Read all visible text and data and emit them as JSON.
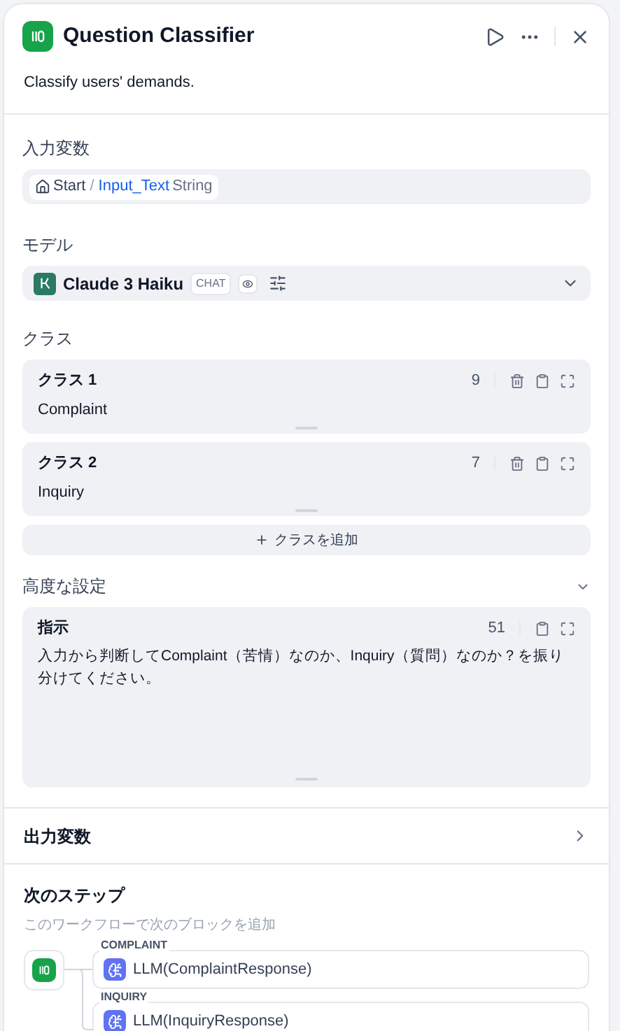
{
  "header": {
    "title": "Question Classifier",
    "description": "Classify users' demands."
  },
  "input_variable": {
    "label": "入力変数",
    "node": "Start",
    "separator": "/",
    "variable": "Input_Text",
    "type": "String"
  },
  "model": {
    "label": "モデル",
    "name": "Claude 3 Haiku",
    "mode": "CHAT"
  },
  "classes": {
    "label": "クラス",
    "items": [
      {
        "title": "クラス 1",
        "count": "9",
        "text": "Complaint"
      },
      {
        "title": "クラス 2",
        "count": "7",
        "text": "Inquiry"
      }
    ],
    "add_button": "クラスを追加"
  },
  "advanced": {
    "label": "高度な設定",
    "expanded": true,
    "instruction": {
      "title": "指示",
      "count": "51",
      "text": "入力から判断してComplaint（苦情）なのか、Inquiry（質問）なのか？を振り分けてください。"
    }
  },
  "output_variables": {
    "label": "出力変数"
  },
  "next_step": {
    "title": "次のステップ",
    "subtitle": "このワークフローで次のブロックを追加",
    "branches": [
      {
        "label": "COMPLAINT",
        "block": "LLM(ComplaintResponse)"
      },
      {
        "label": "INQUIRY",
        "block": "LLM(InquiryResponse)"
      }
    ]
  }
}
